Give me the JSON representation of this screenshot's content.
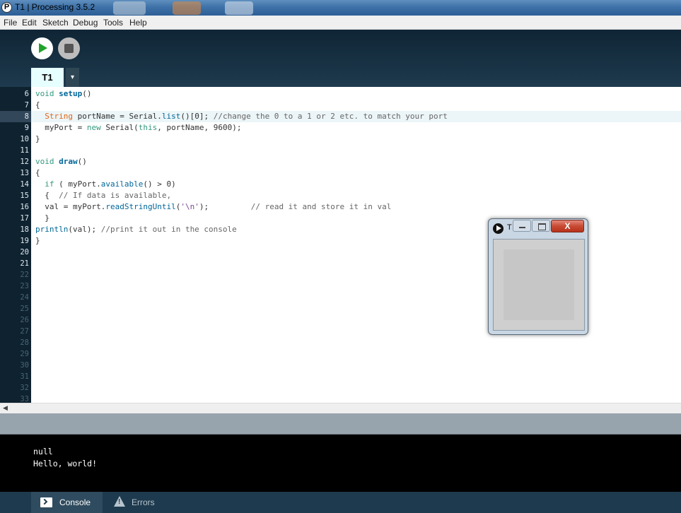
{
  "window": {
    "title": "T1 | Processing 3.5.2",
    "app_icon_letter": "P"
  },
  "menu": [
    "File",
    "Edit",
    "Sketch",
    "Debug",
    "Tools",
    "Help"
  ],
  "toolbar": {
    "run_icon": "play-icon",
    "stop_icon": "stop-icon"
  },
  "tabs": {
    "active": "T1",
    "menu_arrow": "▾"
  },
  "editor": {
    "highlighted_line": 8,
    "line_numbers": [
      "6",
      "7",
      "8",
      "9",
      "10",
      "11",
      "12",
      "13",
      "14",
      "15",
      "16",
      "17",
      "18",
      "19",
      "20",
      "21",
      "22",
      "23",
      "24",
      "25",
      "26",
      "27",
      "28",
      "29",
      "30",
      "31",
      "32",
      "33"
    ],
    "code_lines": [
      "void setup()",
      "{",
      "  String portName = Serial.list()[0]; //change the 0 to a 1 or 2 etc. to match your port",
      "  myPort = new Serial(this, portName, 9600);",
      "}",
      "",
      "void draw()",
      "{",
      "  if ( myPort.available() > 0)",
      "  {  // If data is available,",
      "  val = myPort.readStringUntil('\\n');         // read it and store it in val",
      "  }",
      "println(val); //print it out in the console",
      "}"
    ]
  },
  "console": {
    "lines": [
      "null",
      "Hello, world!"
    ]
  },
  "bottom_tabs": {
    "console_label": "Console",
    "errors_label": "Errors"
  },
  "sketch_window": {
    "title_fragment": "T",
    "close_glyph": "X",
    "canvas_color": "#c6c6c6"
  },
  "colors": {
    "keyword": "#33997e",
    "function": "#006699",
    "type": "#e2661a",
    "comment": "#666666",
    "string": "#7d4793",
    "editor_bg": "#ffffff",
    "gutter_bg": "#0e2230",
    "console_bg": "#000000",
    "tab_bg": "#e6ffff"
  }
}
